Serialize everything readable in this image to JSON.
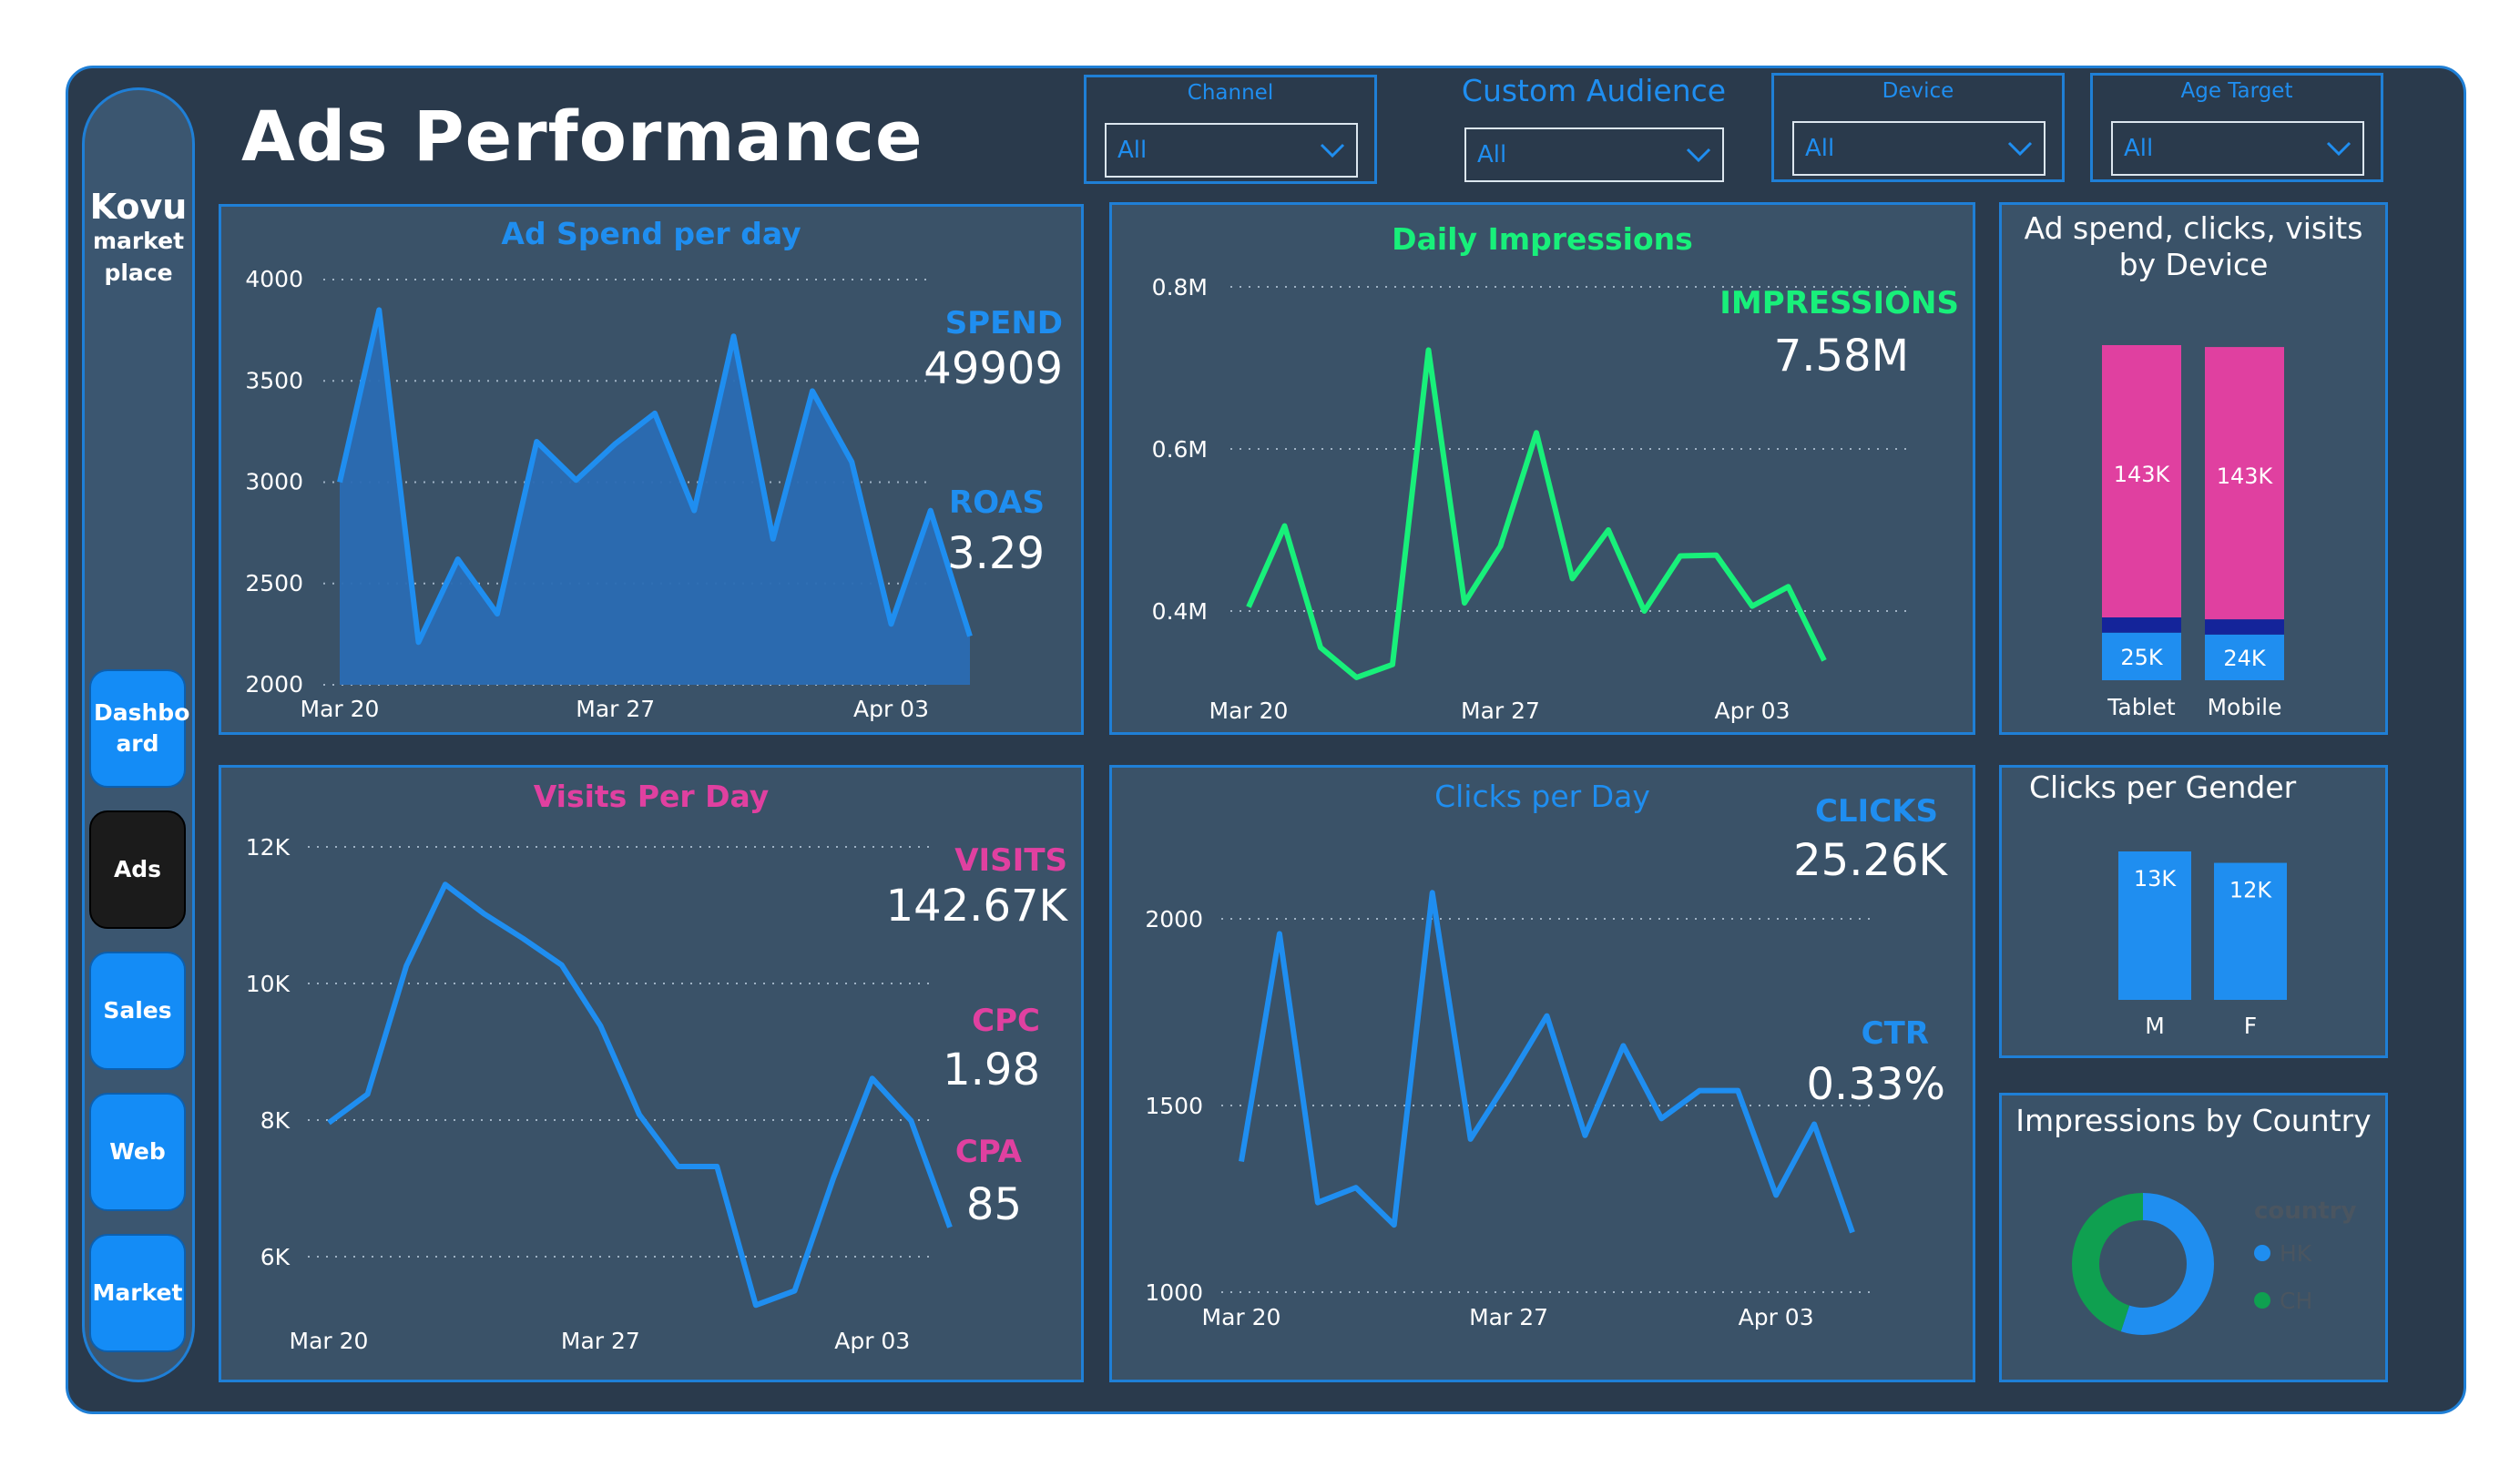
{
  "colors": {
    "blue": "#1f8ef0",
    "green": "#18f07a",
    "pink": "#e040a0",
    "navy": "#14249a",
    "frame": "#2a3a4c",
    "card": "#3a5268"
  },
  "brand": {
    "line1": "Kovu",
    "line2": "market",
    "line3": "place"
  },
  "nav": [
    {
      "label": "Dashbo ard",
      "icon": "dashboard"
    },
    {
      "label": "Ads",
      "icon": "ads"
    },
    {
      "label": "Sales",
      "icon": "sales"
    },
    {
      "label": "Web",
      "icon": "web"
    },
    {
      "label": "Market",
      "icon": "market"
    }
  ],
  "page_title": "Ads Performance",
  "filters": {
    "channel": {
      "label": "Channel",
      "value": "All"
    },
    "custom_audience": {
      "label": "Custom Audience",
      "value": "All"
    },
    "device": {
      "label": "Device",
      "value": "All"
    },
    "age_target": {
      "label": "Age Target",
      "value": "All"
    }
  },
  "kpis": {
    "spend": {
      "label": "SPEND",
      "value": "49909"
    },
    "roas": {
      "label": "ROAS",
      "value": "3.29"
    },
    "impressions": {
      "label": "IMPRESSIONS",
      "value": "7.58M"
    },
    "visits": {
      "label": "VISITS",
      "value": "142.67K"
    },
    "cpc": {
      "label": "CPC",
      "value": "1.98"
    },
    "cpa": {
      "label": "CPA",
      "value": "85"
    },
    "clicks": {
      "label": "CLICKS",
      "value": "25.26K"
    },
    "ctr": {
      "label": "CTR",
      "value": "0.33%"
    }
  },
  "chart_data": [
    {
      "id": "spend",
      "type": "area",
      "title": "Ad Spend per day",
      "x_ticks": [
        "Mar 20",
        "Mar 27",
        "Apr 03"
      ],
      "y_ticks": [
        "2000",
        "2500",
        "3000",
        "3500",
        "4000"
      ],
      "ylim": [
        2000,
        4000
      ],
      "grid": true,
      "values": [
        3000,
        3850,
        2210,
        2620,
        2350,
        3200,
        3010,
        3190,
        3340,
        2860,
        3720,
        2720,
        3450,
        3100,
        2300,
        2860,
        2240
      ]
    },
    {
      "id": "impressions",
      "type": "line",
      "title": "Daily Impressions",
      "x_ticks": [
        "Mar 20",
        "Mar 27",
        "Apr 03"
      ],
      "y_ticks": [
        "0.4M",
        "0.6M",
        "0.8M"
      ],
      "ylim": [
        0.35,
        0.8
      ],
      "grid": true,
      "values": [
        0.405,
        0.505,
        0.355,
        0.318,
        0.334,
        0.722,
        0.41,
        0.48,
        0.62,
        0.44,
        0.5,
        0.4,
        0.468,
        0.469,
        0.406,
        0.43,
        0.339
      ]
    },
    {
      "id": "visits",
      "type": "line",
      "title": "Visits Per Day",
      "x_ticks": [
        "Mar 20",
        "Mar 27",
        "Apr 03"
      ],
      "y_ticks": [
        "6K",
        "8K",
        "10K",
        "12K"
      ],
      "ylim": [
        5000,
        12000
      ],
      "grid": true,
      "values": [
        7960,
        8380,
        10260,
        11450,
        11020,
        10660,
        10270,
        9380,
        8080,
        7320,
        7320,
        5290,
        5500,
        7150,
        8610,
        7990,
        6430
      ]
    },
    {
      "id": "clicks",
      "type": "line",
      "title": "Clicks per Day",
      "x_ticks": [
        "Mar 20",
        "Mar 27",
        "Apr 03"
      ],
      "y_ticks": [
        "1000",
        "1500",
        "2000"
      ],
      "ylim": [
        1000,
        2050
      ],
      "grid": true,
      "values": [
        1350,
        1960,
        1240,
        1280,
        1180,
        2070,
        1410,
        1570,
        1740,
        1420,
        1660,
        1465,
        1540,
        1540,
        1260,
        1450,
        1160
      ]
    },
    {
      "id": "device",
      "type": "bar",
      "title": "Ad spend, clicks, visits by Device",
      "categories": [
        "Tablet",
        "Mobile"
      ],
      "series": [
        {
          "values": [
            25,
            24
          ],
          "labels": [
            "25K",
            "24K"
          ]
        },
        {
          "values": [
            8,
            8
          ],
          "labels": [
            "",
            ""
          ]
        },
        {
          "values": [
            143,
            143
          ],
          "labels": [
            "143K",
            "143K"
          ]
        }
      ],
      "stacked": true
    },
    {
      "id": "gender",
      "type": "bar",
      "title": "Clicks per Gender",
      "categories": [
        "M",
        "F"
      ],
      "values": [
        13,
        12
      ],
      "labels": [
        "13K",
        "12K"
      ]
    },
    {
      "id": "country",
      "type": "pie",
      "title": "Impressions by Country",
      "legend_title": "country",
      "labels": [
        "HK",
        "CH"
      ],
      "values": [
        0.55,
        0.45
      ]
    }
  ]
}
